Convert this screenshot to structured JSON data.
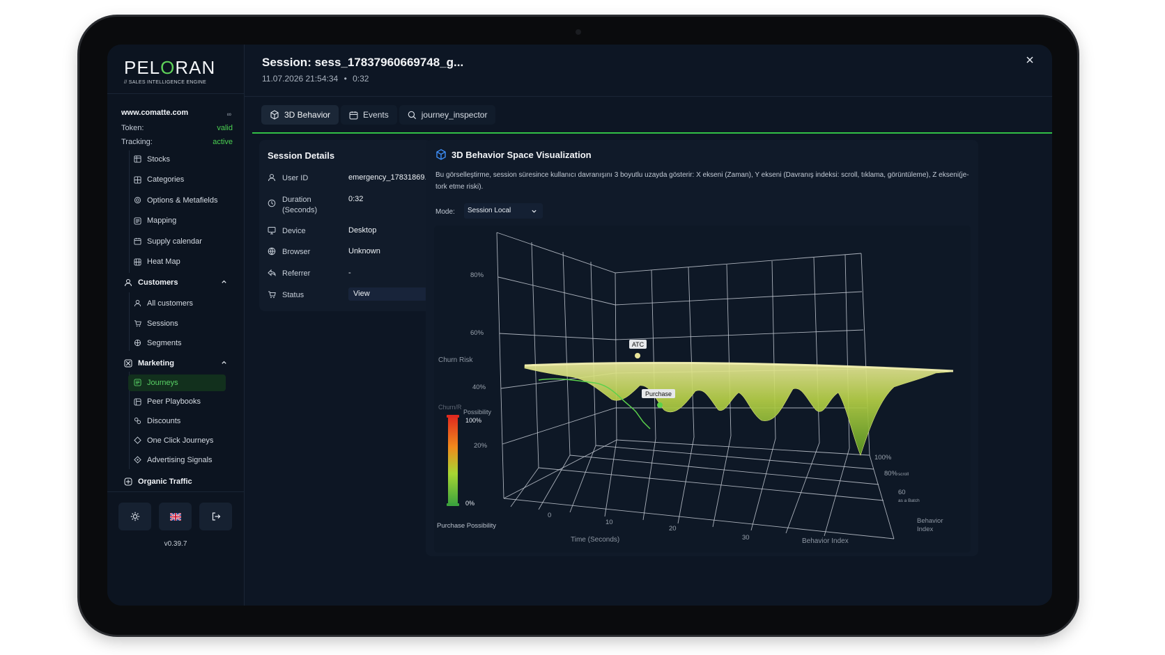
{
  "app": {
    "logo_text": "PELORAN",
    "logo_tagline": "// SALES INTELLIGENCE ENGINE",
    "version": "v0.39.7"
  },
  "site": {
    "domain": "www.comatte.com",
    "token_label": "Token:",
    "token_value": "valid",
    "tracking_label": "Tracking:",
    "tracking_value": "active"
  },
  "sidebar": {
    "top_items": [
      {
        "label": "Stocks",
        "icon": "box-icon"
      },
      {
        "label": "Categories",
        "icon": "grid-icon"
      },
      {
        "label": "Options & Metafields",
        "icon": "options-icon"
      },
      {
        "label": "Mapping",
        "icon": "map-icon"
      },
      {
        "label": "Supply calendar",
        "icon": "calendar-icon"
      },
      {
        "label": "Heat Map",
        "icon": "heatmap-icon"
      }
    ],
    "customers": {
      "label": "Customers",
      "items": [
        {
          "label": "All customers",
          "icon": "user-icon"
        },
        {
          "label": "Sessions",
          "icon": "cart-icon"
        },
        {
          "label": "Segments",
          "icon": "segment-icon"
        }
      ]
    },
    "marketing": {
      "label": "Marketing",
      "items": [
        {
          "label": "Journeys",
          "icon": "journey-icon"
        },
        {
          "label": "Peer Playbooks",
          "icon": "playbook-icon"
        },
        {
          "label": "Discounts",
          "icon": "discount-icon"
        },
        {
          "label": "One Click Journeys",
          "icon": "diamond-icon"
        },
        {
          "label": "Advertising Signals",
          "icon": "signal-icon"
        }
      ]
    },
    "organic": {
      "label": "Organic Traffic",
      "icon": "organic-icon"
    }
  },
  "header": {
    "title": "Session:  sess_17837960669748_g...",
    "date": "11.07.2026 21:54:34",
    "separator": "•",
    "duration": "0:32"
  },
  "tabs": [
    {
      "label": "3D Behavior",
      "icon": "cube-icon",
      "selected": true
    },
    {
      "label": "Events",
      "icon": "calendar-icon",
      "selected": false
    },
    {
      "label": "journey_inspector",
      "icon": "search-icon",
      "selected": false
    }
  ],
  "details": {
    "title": "Session Details",
    "rows": [
      {
        "key": "User ID",
        "value": "emergency_17831869...",
        "icon": "user-icon"
      },
      {
        "key": "Duration (Seconds)",
        "value": "0:32",
        "icon": "clock-icon"
      },
      {
        "key": "Device",
        "value": "Desktop",
        "icon": "monitor-icon"
      },
      {
        "key": "Browser",
        "value": "Unknown",
        "icon": "globe-icon"
      },
      {
        "key": "Referrer",
        "value": "-",
        "icon": "referrer-icon"
      },
      {
        "key": "Status",
        "value": "View",
        "icon": "cart-icon"
      }
    ]
  },
  "viz": {
    "title": "3D Behavior Space Visualization",
    "description": "Bu görselleştirme, session süresince kullanıcı davranışını 3 boyutlu uzayda gösterir: X ekseni (Zaman), Y ekseni (Davranış indeksi: scroll, tıklama, görüntüleme), Z ekseni(je-tork etme riski).",
    "mode_label": "Mode:",
    "mode_value": "Session Local",
    "chart": {
      "z_ticks": [
        "80%",
        "60%",
        "40%",
        "20%"
      ],
      "z_label": "Churn Risk",
      "x_ticks": [
        "0",
        "10",
        "20",
        "30"
      ],
      "x_label": "Time (Seconds)",
      "y_ticks": [
        "100%",
        "80%",
        "60"
      ],
      "y_tick_subs": [
        "",
        "scroll",
        "as a Batch"
      ],
      "y_label": "Behavior Index",
      "y_label_side": "Behavior Index",
      "legend_title_faded": "Churn/R",
      "legend_title": "Possibility",
      "legend_top": "100%",
      "legend_bottom": "0%",
      "legend_caption": "Purchase Possibility",
      "markers": [
        {
          "label": "ATC",
          "color": "#e9e59a"
        },
        {
          "label": "Purchase",
          "color": "#5cd14a"
        }
      ]
    }
  }
}
